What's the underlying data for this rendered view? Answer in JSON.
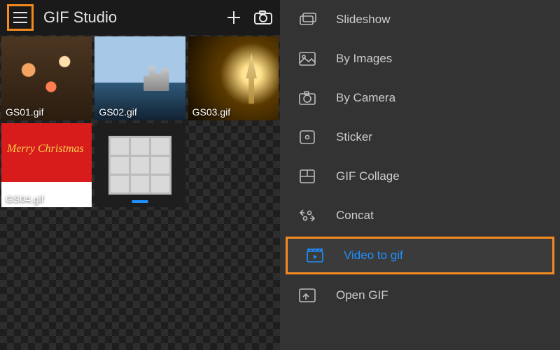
{
  "header": {
    "title": "GIF Studio"
  },
  "thumbs": [
    {
      "fname": "GS01.gif"
    },
    {
      "fname": "GS02.gif"
    },
    {
      "fname": "GS03.gif"
    },
    {
      "fname": "GS04.gif",
      "overlay": "Merry Christmas"
    },
    {
      "fname": ""
    }
  ],
  "menu": [
    {
      "label": "Slideshow",
      "icon": "slideshow-icon"
    },
    {
      "label": "By Images",
      "icon": "images-icon"
    },
    {
      "label": "By Camera",
      "icon": "camera-icon"
    },
    {
      "label": "Sticker",
      "icon": "sticker-icon"
    },
    {
      "label": "GIF Collage",
      "icon": "collage-icon"
    },
    {
      "label": "Concat",
      "icon": "concat-icon"
    },
    {
      "label": "Video to gif",
      "icon": "video-icon",
      "active": true
    },
    {
      "label": "Open GIF",
      "icon": "open-icon"
    }
  ],
  "highlight": {
    "hamburger": true,
    "video_to_gif": true
  },
  "colors": {
    "accent": "#1e90ff",
    "highlight_box": "#f58a1f"
  }
}
